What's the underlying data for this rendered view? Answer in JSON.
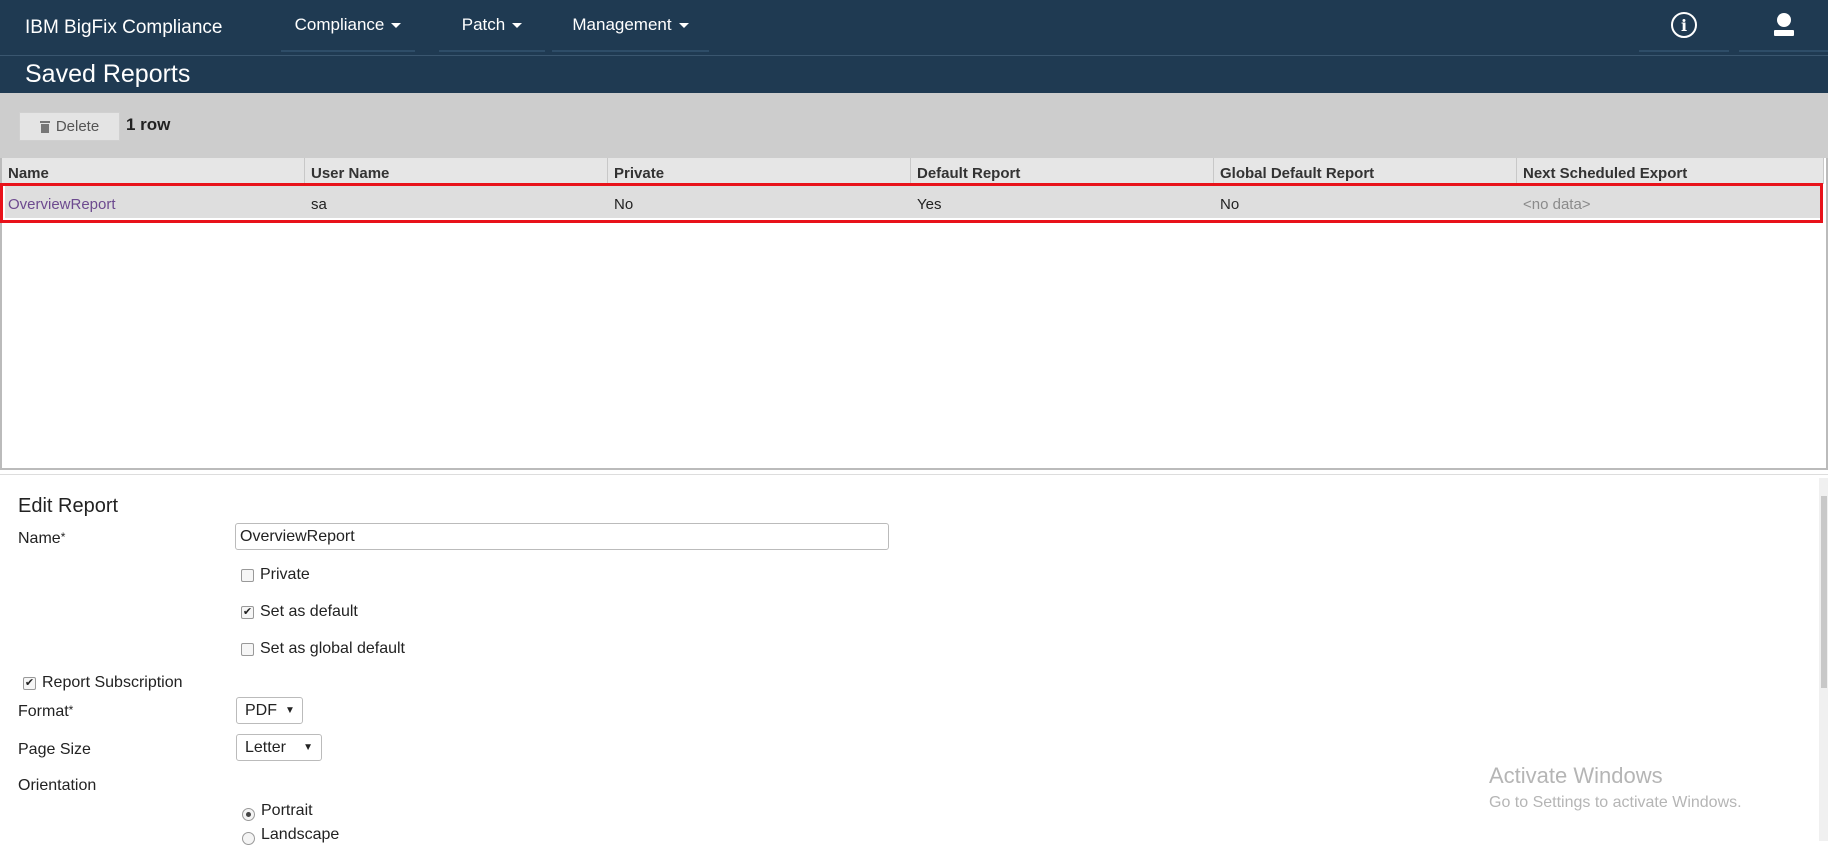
{
  "app": {
    "brand": "IBM BigFix Compliance",
    "menus": [
      {
        "label": "Compliance"
      },
      {
        "label": "Patch"
      },
      {
        "label": "Management"
      }
    ],
    "info_icon_glyph": "i"
  },
  "page": {
    "title": "Saved Reports"
  },
  "toolbar": {
    "delete_label": "Delete",
    "row_count": "1 row"
  },
  "grid": {
    "columns": [
      "Name",
      "User Name",
      "Private",
      "Default Report",
      "Global Default Report",
      "Next Scheduled Export"
    ],
    "rows": [
      [
        "OverviewReport",
        "sa",
        "No",
        "Yes",
        "No",
        "<no data>"
      ]
    ]
  },
  "edit": {
    "title": "Edit Report",
    "name_label": "Name",
    "name_value": "OverviewReport",
    "required_mark": "*",
    "private_label": "Private",
    "private_checked": false,
    "default_label": "Set as default",
    "default_checked": true,
    "global_default_label": "Set as global default",
    "global_default_checked": false,
    "subscription_label": "Report Subscription",
    "subscription_checked": true,
    "format_label": "Format",
    "format_value": "PDF",
    "page_size_label": "Page Size",
    "page_size_value": "Letter",
    "orientation_label": "Orientation",
    "orientation_options": [
      "Portrait",
      "Landscape"
    ],
    "orientation_selected": "Portrait"
  },
  "watermark": {
    "line1": "Activate Windows",
    "line2": "Go to Settings to activate Windows."
  },
  "colors": {
    "nav_bg": "#1f3a52",
    "toolbar_bg": "#cdcdcd",
    "row_bg": "#dedede",
    "highlight": "#e8121a",
    "link": "#6d4a8f"
  }
}
